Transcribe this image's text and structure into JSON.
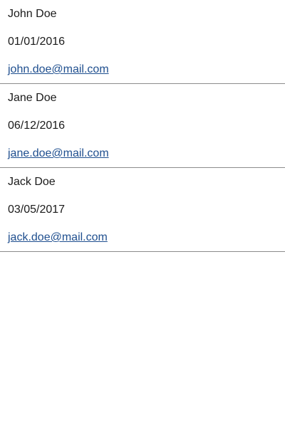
{
  "contacts": [
    {
      "name": "John Doe",
      "date": "01/01/2016",
      "email": "john.doe@mail.com"
    },
    {
      "name": "Jane Doe",
      "date": "06/12/2016",
      "email": "jane.doe@mail.com"
    },
    {
      "name": "Jack Doe",
      "date": "03/05/2017",
      "email": "jack.doe@mail.com"
    }
  ],
  "colors": {
    "link": "#1f4f8f",
    "divider": "#8c8c8c",
    "text": "#1a1a1a"
  }
}
